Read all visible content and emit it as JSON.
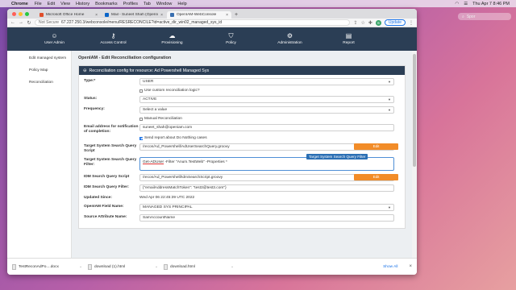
{
  "menubar": {
    "apple": "",
    "app": "Chrome",
    "menus": [
      "File",
      "Edit",
      "View",
      "History",
      "Bookmarks",
      "Profiles",
      "Tab",
      "Window",
      "Help"
    ],
    "datetime": "Thu Apr 7  8:46 PM"
  },
  "desktop": {
    "search_placeholder": "Spor"
  },
  "browser": {
    "tabs": [
      {
        "title": "Microsoft Office Home",
        "icon_color": "#e04e2b",
        "active": false
      },
      {
        "title": "Mail - Suneet Shah (OpenIAM) -",
        "icon_color": "#0a64c8",
        "active": false
      },
      {
        "title": "OpenIAM-WebConsole",
        "icon_color": "#3a6fb0",
        "active": true
      }
    ],
    "url_security": "Not Secure",
    "url": "67.227.250.3/webconsole/menu/RESRECONCILE?id=active_dir_win02_managed_sys_id",
    "update_label": "Update",
    "avatar_letter": "S"
  },
  "nav": [
    {
      "label": "User Admin",
      "icon": "user-icon"
    },
    {
      "label": "Access Control",
      "icon": "key-icon"
    },
    {
      "label": "Provisioning",
      "icon": "cloud-icon"
    },
    {
      "label": "Policy",
      "icon": "shield-icon"
    },
    {
      "label": "Administration",
      "icon": "gear-icon"
    },
    {
      "label": "Report",
      "icon": "report-icon"
    }
  ],
  "sidebar": {
    "items": [
      {
        "label": "Edit managed system"
      },
      {
        "label": "Policy Map"
      },
      {
        "label": "Reconciliation"
      }
    ]
  },
  "page": {
    "title": "OpenIAM - Edit Reconciliation configuration",
    "panel_title": "Reconciliation config for resource: Ad Powershell Managed Sys"
  },
  "form": {
    "type_label": "Type:*",
    "type_value": "USER",
    "custom_logic_label": "Use custom reconciliation logic?",
    "status_label": "Status:",
    "status_value": "ACTIVE",
    "frequency_label": "Frequency:",
    "frequency_value": "Select a value",
    "manual_label": "Manual Reconciliation",
    "email_label": "Email address for notification of completion:",
    "email_value": "suneet_shah@openiam.com",
    "send_report_label": "Send report about Do Nothing cases",
    "target_script_label": "Target System Search Query Script",
    "target_script_value": "/recon/Ad_Powershell/AdUserSearchQuery.groovy",
    "edit_label": "Edit",
    "tooltip": "Target System Search Query Filter",
    "target_filter_label": "Target System Search Query Filter:",
    "target_filter_cmd": "Get-ADUser",
    "target_filter_rest": " -Filter \"Anum.TestWeb\" -Properties *",
    "idm_script_label": "IDM Search Query Script",
    "idm_script_value": "/recon/Ad_Powershell/IdmSearchScript.groovy",
    "idm_filter_label": "IDM Search Query Filter:",
    "idm_filter_value": "{\"emailAddressMatchToken\": \"test3@test3.com\"}",
    "updated_label": "Updated Since:",
    "updated_value": "Wed Apr 06 22:45:39 UTC 2022",
    "openiam_field_label": "OpenIAM Field Name:",
    "openiam_field_value": "MANAGED SYS PRINCIPAL",
    "source_attr_label": "Source Attribute Name:",
    "source_attr_value": "SamAccountName"
  },
  "downloads": {
    "items": [
      {
        "name": "TestReconAdPo....docx"
      },
      {
        "name": "download (1).html"
      },
      {
        "name": "download.html"
      }
    ],
    "show_all": "Show All"
  },
  "colors": {
    "nav_bg": "#2b3e55",
    "accent": "#f28c28",
    "link": "#1a73e8"
  }
}
